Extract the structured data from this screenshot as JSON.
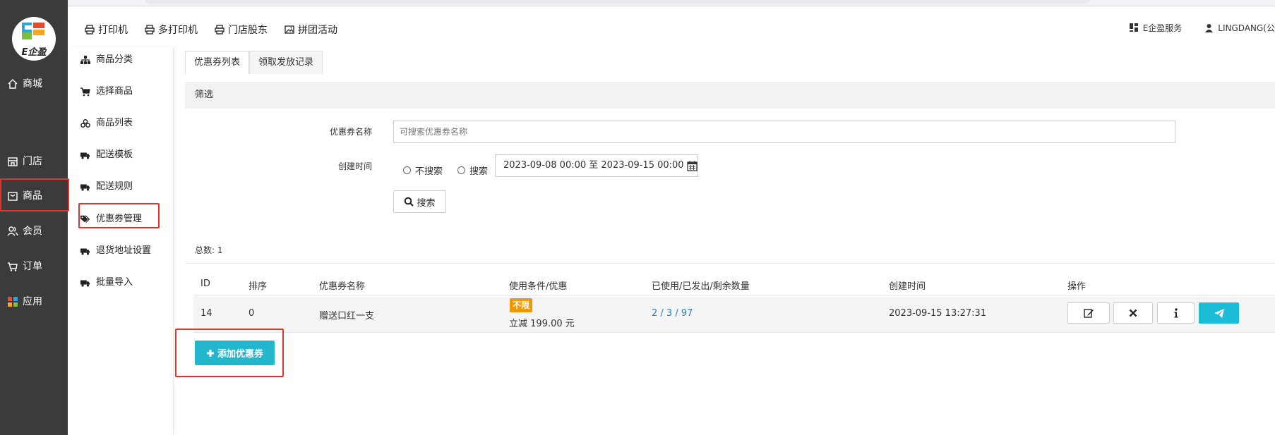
{
  "sidebar": {
    "logo_text": "E企盈",
    "items": [
      {
        "label": "商城",
        "icon": "home-icon"
      },
      {
        "label": "门店",
        "icon": "store-icon"
      },
      {
        "label": "商品",
        "icon": "goods-icon"
      },
      {
        "label": "会员",
        "icon": "members-icon"
      },
      {
        "label": "订单",
        "icon": "cart-icon"
      },
      {
        "label": "应用",
        "icon": "apps-icon"
      }
    ]
  },
  "topnav": {
    "items": [
      {
        "label": "打印机",
        "icon": "printer-icon"
      },
      {
        "label": "多打印机",
        "icon": "printer-icon"
      },
      {
        "label": "门店股东",
        "icon": "printer-icon"
      },
      {
        "label": "拼团活动",
        "icon": "image-icon"
      }
    ],
    "right": [
      {
        "label": "E企盈服务",
        "icon": "grid-icon"
      },
      {
        "label": "LINGDANG(公",
        "icon": "user-icon"
      }
    ]
  },
  "subsidebar": {
    "items": [
      {
        "label": "商品分类",
        "icon": "sitemap-icon"
      },
      {
        "label": "选择商品",
        "icon": "cart-icon"
      },
      {
        "label": "商品列表",
        "icon": "cubes-icon"
      },
      {
        "label": "配送模板",
        "icon": "truck-icon"
      },
      {
        "label": "配送规则",
        "icon": "truck-icon"
      },
      {
        "label": "优惠券管理",
        "icon": "tags-icon"
      },
      {
        "label": "退货地址设置",
        "icon": "truck-icon"
      },
      {
        "label": "批量导入",
        "icon": "truck-icon"
      }
    ]
  },
  "tabs": [
    {
      "label": "优惠券列表",
      "active": true
    },
    {
      "label": "领取发放记录",
      "active": false
    }
  ],
  "filter": {
    "title": "筛选",
    "name_label": "优惠券名称",
    "name_placeholder": "可搜索优惠券名称",
    "time_label": "创建时间",
    "radio_no_search": "不搜索",
    "radio_search": "搜索",
    "date_range": "2023-09-08 00:00 至 2023-09-15 00:00",
    "search_button": "搜索"
  },
  "total_text": "总数: 1",
  "table": {
    "headers": [
      "ID",
      "排序",
      "优惠券名称",
      "使用条件/优惠",
      "已使用/已发出/剩余数量",
      "创建时间",
      "操作"
    ],
    "rows": [
      {
        "id": "14",
        "sort": "0",
        "name": "赠送口红一支",
        "condition_badge": "不限",
        "condition_text": "立减 199.00 元",
        "stats": "2 / 3 / 97",
        "created": "2023-09-15 13:27:31"
      }
    ]
  },
  "add_button": "添加优惠券",
  "colors": {
    "sidebar_bg": "#3b3b3b",
    "accent_cyan": "#23b7ce",
    "badge_orange": "#f39800",
    "highlight_red": "#e4312a",
    "link_blue": "#2b7ec4"
  }
}
